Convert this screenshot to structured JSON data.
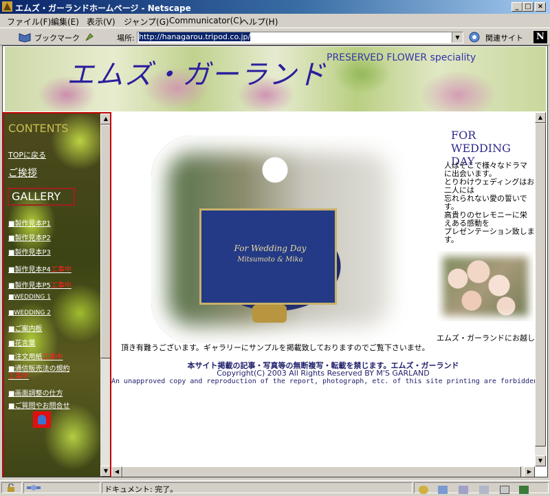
{
  "window": {
    "title": "エムズ・ガーランドホームページ - Netscape",
    "buttons": [
      "_",
      "□",
      "×"
    ]
  },
  "menu": [
    "ファイル(F)",
    "編集(E)",
    "表示(V)",
    "ジャンプ(G)",
    "Communicator(C)",
    "ヘルプ(H)"
  ],
  "toolbar": {
    "bookmarks_label": "ブックマーク",
    "location_label": "場所:",
    "url": "http://hanagarou.tripod.co.jp/",
    "related_label": "関連サイト",
    "netscape_logo": "N"
  },
  "banner": {
    "title": "エムズ・ガーランド",
    "subtitle": "PRESERVED FLOWER speciality"
  },
  "sidebar": {
    "heading": "CONTENTS",
    "top_link": "TOPに戻る",
    "greeting_link": "ご挨拶",
    "gallery": "GALLERY",
    "links": [
      {
        "label": "■製作見本P1",
        "wip": ""
      },
      {
        "label": "■製作見本P2",
        "wip": ""
      },
      {
        "label": "■製作見本P3",
        "wip": ""
      },
      {
        "label": "■製作見本P4",
        "wip": "工事中"
      },
      {
        "label": "■製作見本P5",
        "wip": "工事中"
      },
      {
        "label": "■WEDDING 1",
        "wip": ""
      },
      {
        "label": "■WEDDING 2",
        "wip": ""
      },
      {
        "label": "■ご案内板",
        "wip": ""
      },
      {
        "label": "■花言葉",
        "wip": ""
      },
      {
        "label": "■注文用紙",
        "wip": "工事中"
      },
      {
        "label": "■通信販売法の規約",
        "wip": "工事中"
      },
      {
        "label": "■画面調整の仕方",
        "wip": ""
      },
      {
        "label": "■ご質問やお問合せ",
        "wip": ""
      }
    ]
  },
  "main": {
    "heading_lines": [
      "FOR",
      "WEDDING",
      "DAY"
    ],
    "sign_lines": [
      "For Wedding Day",
      "Mitsumoto & Mika"
    ],
    "description_lines": [
      "人はそこで様々なドラマ",
      "に出会います。",
      "とりわけウェディングはお",
      "二人には",
      "忘れられない愛の誓いで",
      "す。",
      "高貴りのセレモニーに栄",
      "えある感動を",
      "プレゼンテーション致しま",
      "す。"
    ],
    "greeting_1": "エムズ・ガーランドにお越し",
    "greeting_2": "頂き有難うございます。ギャラリーにサンプルを掲載致しておりますのでご覧下さいませ。",
    "notice": "本サイト掲載の記事・写真等の無断複写・転載を禁じます。エムズ・ガーランド",
    "copyright": "Copyright(C) 2003 All Rights Reserved  BY  M'S  GARLAND",
    "english_notice": "An unapproved copy and reproduction of the report, photograph, etc. of this site printing are forbidden."
  },
  "status": {
    "text": "ドキュメント: 完了。"
  },
  "icons": [
    "netscape-app-icon",
    "bookmarks-icon",
    "link-icon",
    "related-sites-icon",
    "lock-icon",
    "connection-icon",
    "mail-icon"
  ]
}
